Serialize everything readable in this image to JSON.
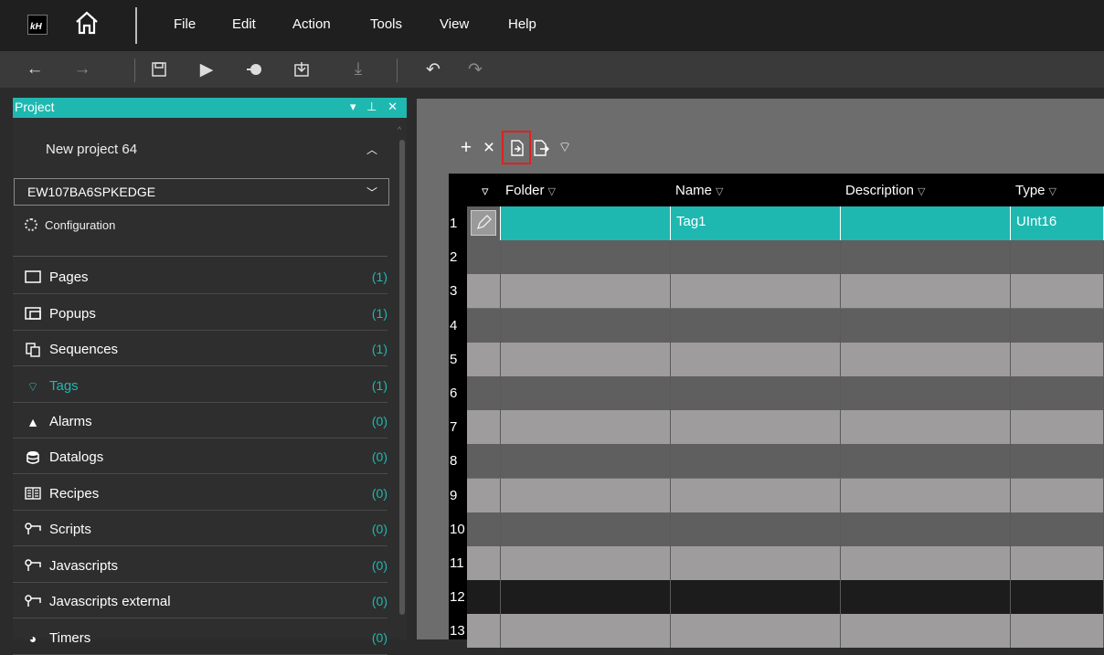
{
  "menubar": {
    "logo_text": "kH",
    "items": [
      "File",
      "Edit",
      "Action",
      "Tools",
      "View",
      "Help"
    ]
  },
  "toolbar": {
    "buttons": [
      "back-arrow-icon",
      "forward-arrow-icon",
      "save-icon",
      "play-icon",
      "simulate-icon",
      "download-box-icon",
      "download-icon",
      "undo-icon",
      "redo-icon"
    ]
  },
  "project_panel": {
    "title": "Project",
    "controls": "▾ ⊥ ✕",
    "project_name": "New project 64",
    "device": "EW107BA6SPKEDGE",
    "configuration_label": "Configuration",
    "items": [
      {
        "label": "Pages",
        "count": "(1)",
        "icon": "page-icon"
      },
      {
        "label": "Popups",
        "count": "(1)",
        "icon": "popup-icon"
      },
      {
        "label": "Sequences",
        "count": "(1)",
        "icon": "sequence-icon"
      },
      {
        "label": "Tags",
        "count": "(1)",
        "icon": "tag-icon",
        "active": true
      },
      {
        "label": "Alarms",
        "count": "(0)",
        "icon": "alarm-icon"
      },
      {
        "label": "Datalogs",
        "count": "(0)",
        "icon": "datalog-icon"
      },
      {
        "label": "Recipes",
        "count": "(0)",
        "icon": "recipe-icon"
      },
      {
        "label": "Scripts",
        "count": "(0)",
        "icon": "script-icon"
      },
      {
        "label": "Javascripts",
        "count": "(0)",
        "icon": "script-icon"
      },
      {
        "label": "Javascripts external",
        "count": "(0)",
        "icon": "script-icon"
      },
      {
        "label": "Timers",
        "count": "(0)",
        "icon": "timer-icon"
      }
    ]
  },
  "grid": {
    "toolbar": [
      "add-icon",
      "delete-icon",
      "import-icon",
      "export-icon",
      "tag-import-icon"
    ],
    "headers": {
      "folder": "Folder",
      "name": "Name",
      "description": "Description",
      "type": "Type"
    },
    "rows": [
      {
        "num": "1",
        "folder": "",
        "name": "Tag1",
        "description": "",
        "type": "UInt16"
      },
      {
        "num": "2"
      },
      {
        "num": "3"
      },
      {
        "num": "4"
      },
      {
        "num": "5"
      },
      {
        "num": "6"
      },
      {
        "num": "7"
      },
      {
        "num": "8"
      },
      {
        "num": "9"
      },
      {
        "num": "10"
      },
      {
        "num": "11"
      },
      {
        "num": "12"
      },
      {
        "num": "13"
      }
    ],
    "colors": {
      "selected": "#1fb8b0",
      "row_light": "#9e9c9c",
      "row_dark": "#5f5f5f",
      "row_black": "#1c1c1c"
    }
  }
}
